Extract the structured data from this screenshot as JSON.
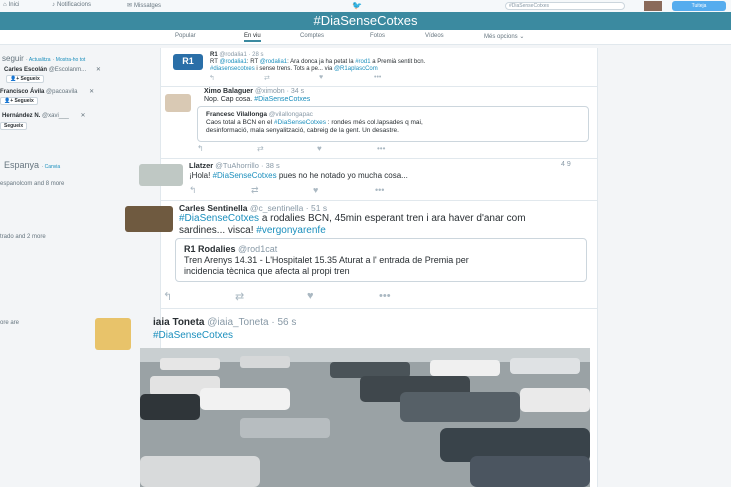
{
  "nav": {
    "home": "Inici",
    "notifications": "Notificacions",
    "messages": "Missatges",
    "search_value": "#DiaSenseCotxes",
    "tweet_button": "Tuiteja"
  },
  "banner": {
    "title": "#DiaSenseCotxes"
  },
  "tabs": [
    "Popular",
    "En viu",
    "Comptes",
    "Fotos",
    "Vídeos",
    "Més opcions ⌄"
  ],
  "left": {
    "who_to_follow": "seguir",
    "refresh": "Actualitza",
    "view_all": "Mostra-ho tot",
    "suggestions": [
      {
        "name": "Carles Escolán",
        "handle": "@Escolanm...",
        "action": "Segueix"
      },
      {
        "name": "Francisco Ávila",
        "handle": "@pacoavila",
        "action": "Segueix"
      },
      {
        "name": "Hernández N.",
        "handle": "@xavi___",
        "action": "Segueix"
      }
    ],
    "trends_title": "Espanya",
    "trends_change": "Canvia",
    "trend_line1": "espanolcom and 8 more",
    "trend_line2": "trado and 2 more",
    "trend_line3": "ore are"
  },
  "tweets": {
    "t1": {
      "name": "R1",
      "handle": "@rodalia1",
      "time": "28 s",
      "avatar_text": "R1",
      "line1_a": "RT ",
      "line1_b": "@rodalia1",
      "line1_c": ": RT ",
      "line1_d": "@rodalia1",
      "line1_e": ": Ara donca ja ha petat la ",
      "line1_f": "#rod1",
      "line1_g": " a Premià sentit bcn.",
      "line2_a": "#diasensecotxes",
      "line2_b": " i sense trens. Tots a pe... via ",
      "line2_c": "@R1aplascCom"
    },
    "t2": {
      "name": "Ximo Balaguer",
      "handle": "@ximobn",
      "time": "34 s",
      "text_a": "Nop. Cap cosa. ",
      "text_b": "#DiaSenseCotxes",
      "quote_name": "Francesc Vilallonga",
      "quote_handle": "@vilallongapac",
      "quote_line1_a": "Caos total a BCN en el ",
      "quote_line1_b": "#DiaSenseCotxes",
      "quote_line1_c": " : rondes més col.lapsades q mai,",
      "quote_line2": "desinformació, mala senyalització, cabreig de la gent. Un desastre."
    },
    "t3": {
      "name": "Llatzer",
      "handle": "@TuAhorrillo",
      "time": "38 s",
      "text_a": "¡Hola! ",
      "text_b": "#DiaSenseCotxes",
      "text_c": " pues no he notado yo mucha cosa...",
      "counts": "4 9"
    },
    "t4": {
      "name": "Carles Sentinella",
      "handle": "@c_sentinella",
      "time": "51 s",
      "line1_a": "#DiaSenseCotxes",
      "line1_b": " a rodalies BCN, 45min esperant tren i ara haver d'anar com",
      "line2_a": "sardines... visca! ",
      "line2_b": "#vergonyarenfe",
      "quote_name": "R1 Rodalies",
      "quote_handle": "@rod1cat",
      "quote_line1": "Tren Arenys 14.31 - L'Hospitalet 15.35 Aturat a l' entrada de Premia per",
      "quote_line2": "incidencia tècnica que afecta al propi tren"
    },
    "t5": {
      "name": "iaia Toneta",
      "handle": "@iaia_Toneta",
      "time": "56 s",
      "text": "#DiaSenseCotxes"
    }
  },
  "icons": {
    "reply": "↰",
    "retweet": "⇄",
    "like": "♥",
    "more": "•••"
  },
  "colors": {
    "accent": "#3b8aa0",
    "link": "#1b8fbd",
    "brand": "#55acee"
  }
}
